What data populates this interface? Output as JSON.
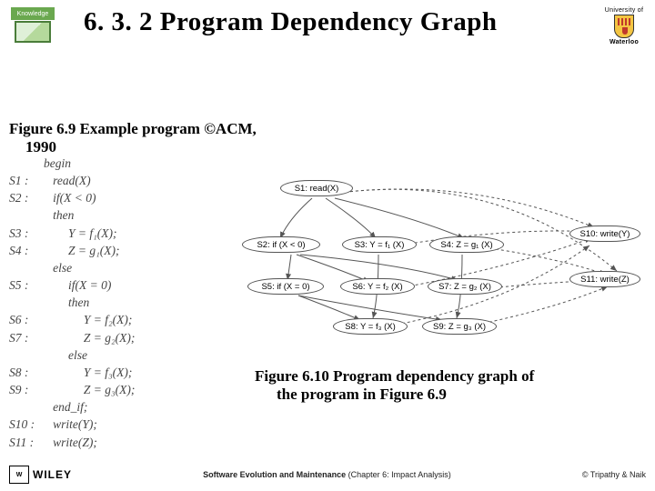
{
  "header": {
    "logo_left_text": "Knowledge",
    "title": "6. 3. 2 Program Dependency Graph",
    "logo_right_top": "University of",
    "logo_right_name": "Waterloo"
  },
  "caption1": {
    "line1": "Figure 6.9 Example program ©ACM,",
    "line2": "1990"
  },
  "program": {
    "begin": "begin",
    "s1_lbl": "S1 :",
    "s1_code": "read(X)",
    "s2_lbl": "S2 :",
    "s2_code": "if(X < 0)",
    "then1": "then",
    "s3_lbl": "S3 :",
    "s3_code": "Y = f₁(X);",
    "s4_lbl": "S4 :",
    "s4_code": "Z = g₁(X);",
    "else1": "else",
    "s5_lbl": "S5 :",
    "s5_code": "if(X = 0)",
    "then2": "then",
    "s6_lbl": "S6 :",
    "s6_code": "Y = f₂(X);",
    "s7_lbl": "S7 :",
    "s7_code": "Z = g₂(X);",
    "else2": "else",
    "s8_lbl": "S8 :",
    "s8_code": "Y = f₃(X);",
    "s9_lbl": "S9 :",
    "s9_code": "Z = g₃(X);",
    "endif": "end_if;",
    "s10_lbl": "S10 :",
    "s10_code": "write(Y);",
    "s11_lbl": "S11 :",
    "s11_code": "write(Z);"
  },
  "graph": {
    "n1": "S1: read(X)",
    "n2": "S2: if (X < 0)",
    "n3": "S3: Y = f₁ (X)",
    "n4": "S4: Z = g₁ (X)",
    "n5": "S5: if (X = 0)",
    "n6": "S6: Y = f₂ (X)",
    "n7": "S7: Z = g₂ (X)",
    "n8": "S8: Y = f₃ (X)",
    "n9": "S9: Z = g₃ (X)",
    "n10": "S10: write(Y)",
    "n11": "S11: write(Z)"
  },
  "caption2": {
    "line1": "Figure 6.10 Program dependency graph of",
    "line2": "the program in Figure 6.9"
  },
  "footer": {
    "wiley_mark": "W",
    "wiley_text": "WILEY",
    "mid_bold": "Software Evolution and Maintenance",
    "mid_rest": " (Chapter 6: Impact Analysis)",
    "right": "© Tripathy & Naik"
  }
}
